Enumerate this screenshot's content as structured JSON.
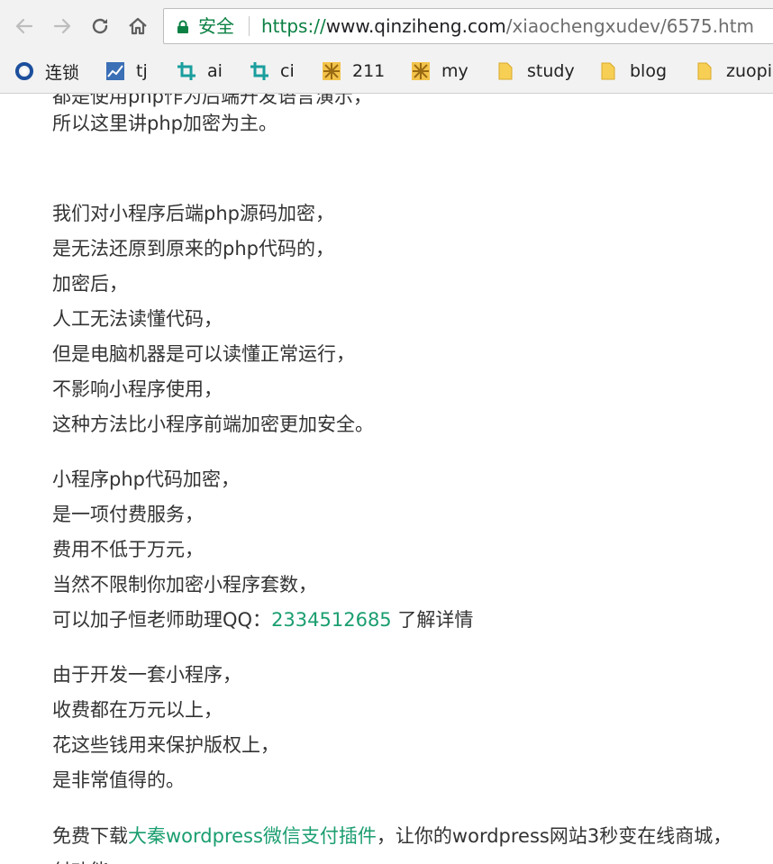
{
  "browser": {
    "secure_label": "安全",
    "url": {
      "scheme": "https://",
      "host": "www.qinziheng.com",
      "path": "/xiaochengxudev/6575.htm"
    },
    "bookmarks": [
      {
        "label": "连锁",
        "icon": "network-icon"
      },
      {
        "label": "tj",
        "icon": "chart-icon"
      },
      {
        "label": "ai",
        "icon": "crop-icon"
      },
      {
        "label": "ci",
        "icon": "crop-icon"
      },
      {
        "label": "211",
        "icon": "pattern-icon"
      },
      {
        "label": "my",
        "icon": "pattern-icon"
      },
      {
        "label": "study",
        "icon": "folder-icon"
      },
      {
        "label": "blog",
        "icon": "folder-icon"
      },
      {
        "label": "zuopin",
        "icon": "folder-icon"
      }
    ]
  },
  "article": {
    "partial_top_line": "都是使用php作为后端开发语言演示，",
    "para1": [
      "所以这里讲php加密为主。"
    ],
    "para2": [
      "我们对小程序后端php源码加密，",
      "是无法还原到原来的php代码的，",
      "加密后，",
      "人工无法读懂代码，",
      "但是电脑机器是可以读懂正常运行，",
      "不影响小程序使用，",
      "这种方法比小程序前端加密更加安全。"
    ],
    "para3": [
      "小程序php代码加密，",
      "是一项付费服务，",
      "费用不低于万元，",
      "当然不限制你加密小程序套数，"
    ],
    "qq_line": {
      "prefix": "可以加子恒老师助理QQ：",
      "qq": "2334512685",
      "suffix": " 了解详情"
    },
    "para4": [
      "由于开发一套小程序，",
      "收费都在万元以上，",
      "花这些钱用来保护版权上，",
      "是非常值得的。"
    ],
    "promo": {
      "prefix": "免费下载",
      "link": "大秦wordpress微信支付插件",
      "suffix": "，让你的wordpress网站3秒变在线商城，",
      "partial_next": "付功能"
    }
  },
  "colors": {
    "accent_green": "#1a9e6f",
    "secure_green": "#0b8043",
    "text": "#333333"
  }
}
